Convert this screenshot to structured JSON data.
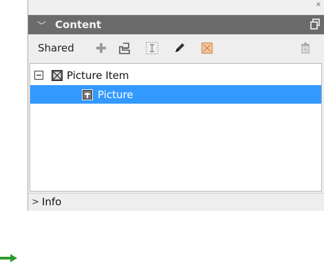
{
  "panel": {
    "title": "Content",
    "toolbar": {
      "shared_label": "Shared",
      "icons": [
        "add-icon",
        "import-icon",
        "text-frame-icon",
        "edit-icon",
        "picture-frame-icon",
        "delete-icon"
      ]
    },
    "tree": [
      {
        "label": "Picture Item",
        "expanded": true,
        "selected": false,
        "icon": "picture-item-icon"
      },
      {
        "label": "Picture",
        "selected": true,
        "icon": "picture-icon"
      }
    ],
    "info_label": "Info"
  },
  "colors": {
    "header_bg": "#6b6b6b",
    "selection": "#3399ff",
    "arrow": "#2e9a2e"
  }
}
